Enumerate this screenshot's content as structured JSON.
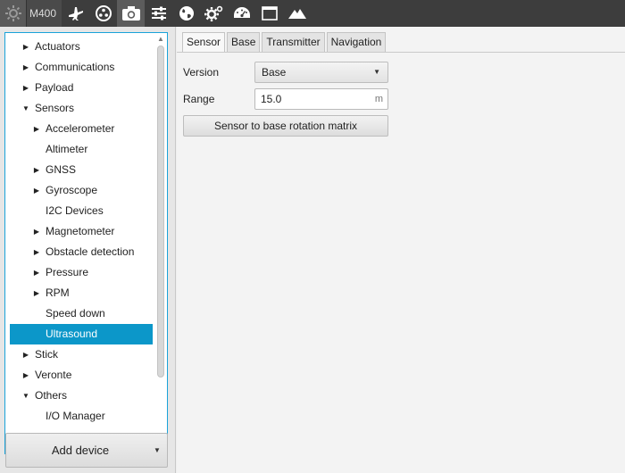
{
  "toolbar": {
    "model_label": "M400",
    "icons": [
      "settings-icon",
      "airplane-icon",
      "dots-circle-icon",
      "camera-icon",
      "sliders-icon",
      "globe-icon",
      "gears-icon",
      "speedometer-icon",
      "window-icon",
      "mountains-icon"
    ],
    "active_icon": "camera-icon"
  },
  "tree": {
    "items": [
      {
        "label": "Actuators",
        "level": 0,
        "arrow": "right"
      },
      {
        "label": "Communications",
        "level": 0,
        "arrow": "right"
      },
      {
        "label": "Payload",
        "level": 0,
        "arrow": "right"
      },
      {
        "label": "Sensors",
        "level": 0,
        "arrow": "down"
      },
      {
        "label": "Accelerometer",
        "level": 1,
        "arrow": "right"
      },
      {
        "label": "Altimeter",
        "level": 1,
        "arrow": ""
      },
      {
        "label": "GNSS",
        "level": 1,
        "arrow": "right"
      },
      {
        "label": "Gyroscope",
        "level": 1,
        "arrow": "right"
      },
      {
        "label": "I2C Devices",
        "level": 1,
        "arrow": ""
      },
      {
        "label": "Magnetometer",
        "level": 1,
        "arrow": "right"
      },
      {
        "label": "Obstacle detection",
        "level": 1,
        "arrow": "right"
      },
      {
        "label": "Pressure",
        "level": 1,
        "arrow": "right"
      },
      {
        "label": "RPM",
        "level": 1,
        "arrow": "right"
      },
      {
        "label": "Speed down",
        "level": 1,
        "arrow": ""
      },
      {
        "label": "Ultrasound",
        "level": 1,
        "arrow": "",
        "selected": true
      },
      {
        "label": "Stick",
        "level": 0,
        "arrow": "right"
      },
      {
        "label": "Veronte",
        "level": 0,
        "arrow": "right"
      },
      {
        "label": "Others",
        "level": 0,
        "arrow": "down"
      },
      {
        "label": "I/O Manager",
        "level": 1,
        "arrow": ""
      }
    ]
  },
  "add_device": {
    "label": "Add device"
  },
  "tabs": [
    {
      "label": "Sensor",
      "active": true
    },
    {
      "label": "Base"
    },
    {
      "label": "Transmitter"
    },
    {
      "label": "Navigation"
    }
  ],
  "form": {
    "version_label": "Version",
    "version_value": "Base",
    "range_label": "Range",
    "range_value": "15.0",
    "range_unit": "m",
    "matrix_button": "Sensor to base rotation matrix"
  },
  "colors": {
    "toolbar_bg": "#3d3d3d",
    "selection": "#0c97c9",
    "tree_border": "#1aa3d9"
  }
}
